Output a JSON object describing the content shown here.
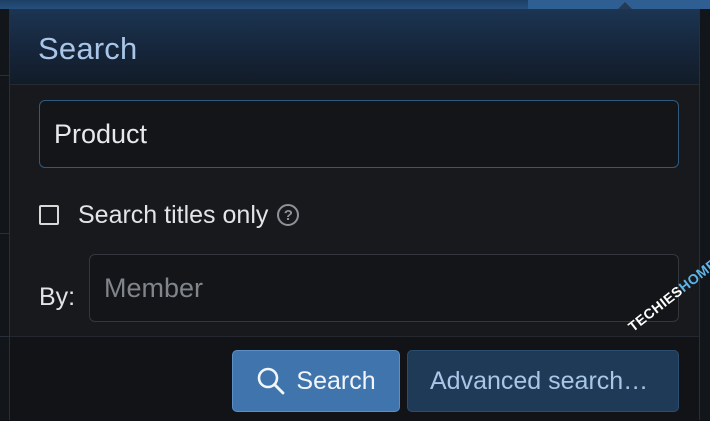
{
  "popup": {
    "title": "Search"
  },
  "search": {
    "query_value": "Product"
  },
  "options": {
    "titles_only_label": "Search titles only",
    "titles_only_checked": false,
    "help_icon": "question-circle-icon"
  },
  "member": {
    "label": "By:",
    "placeholder": "Member"
  },
  "buttons": {
    "search_label": "Search",
    "search_icon": "search-icon",
    "advanced_label": "Advanced search…"
  },
  "watermark": {
    "prefix": "TECHIES",
    "suffix": "HOME.COM"
  },
  "colors": {
    "title": "#a9c6e8",
    "primary_button": "#3f74ad",
    "secondary_button": "#1f3a57"
  }
}
